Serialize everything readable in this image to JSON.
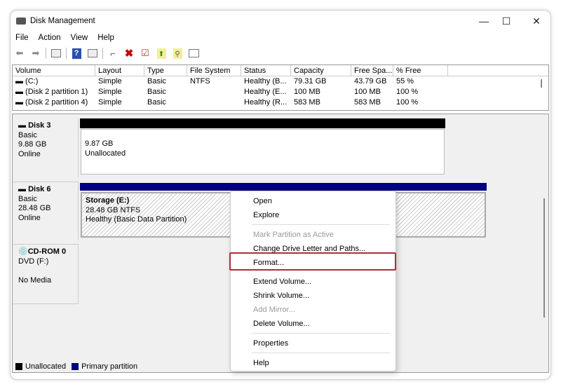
{
  "window": {
    "title": "Disk Management",
    "minimize": "—",
    "maximize": "☐",
    "close": "✕"
  },
  "menubar": [
    "File",
    "Action",
    "View",
    "Help"
  ],
  "toolbar": [
    "back-icon",
    "forward-icon",
    "console-tree-icon",
    "help-icon",
    "action-pane-icon",
    "connect-icon",
    "delete-icon",
    "check-icon",
    "import-icon",
    "search-icon",
    "properties-icon"
  ],
  "volume_list": {
    "columns": [
      "Volume",
      "Layout",
      "Type",
      "File System",
      "Status",
      "Capacity",
      "Free Spa...",
      "% Free"
    ],
    "rows": [
      [
        "(C:)",
        "Simple",
        "Basic",
        "NTFS",
        "Healthy (B...",
        "79.31 GB",
        "43.79 GB",
        "55 %"
      ],
      [
        "(Disk 2 partition 1)",
        "Simple",
        "Basic",
        "",
        "Healthy (E...",
        "100 MB",
        "100 MB",
        "100 %"
      ],
      [
        "(Disk 2 partition 4)",
        "Simple",
        "Basic",
        "",
        "Healthy (R...",
        "583 MB",
        "583 MB",
        "100 %"
      ]
    ]
  },
  "disks": [
    {
      "name": "Disk 3",
      "type": "Basic",
      "size": "9.88 GB",
      "status": "Online",
      "part_size": "9.87 GB",
      "part_label": "Unallocated"
    },
    {
      "name": "Disk 6",
      "type": "Basic",
      "size": "28.48 GB",
      "status": "Online",
      "part_name": "Storage  (E:)",
      "part_size": "28.48 GB NTFS",
      "part_status": "Healthy (Basic Data Partition)"
    },
    {
      "name": "CD-ROM 0",
      "type": "DVD (F:)",
      "status": "No Media"
    }
  ],
  "legend": {
    "unallocated": "Unallocated",
    "primary": "Primary partition",
    "colors": {
      "unallocated": "#000000",
      "primary": "#000080"
    }
  },
  "context_menu": {
    "open": "Open",
    "explore": "Explore",
    "mark_active": "Mark Partition as Active",
    "change_letter": "Change Drive Letter and Paths...",
    "format": "Format...",
    "extend": "Extend Volume...",
    "shrink": "Shrink Volume...",
    "add_mirror": "Add Mirror...",
    "delete": "Delete Volume...",
    "properties": "Properties",
    "help": "Help"
  },
  "highlight_color": "#b5293a"
}
